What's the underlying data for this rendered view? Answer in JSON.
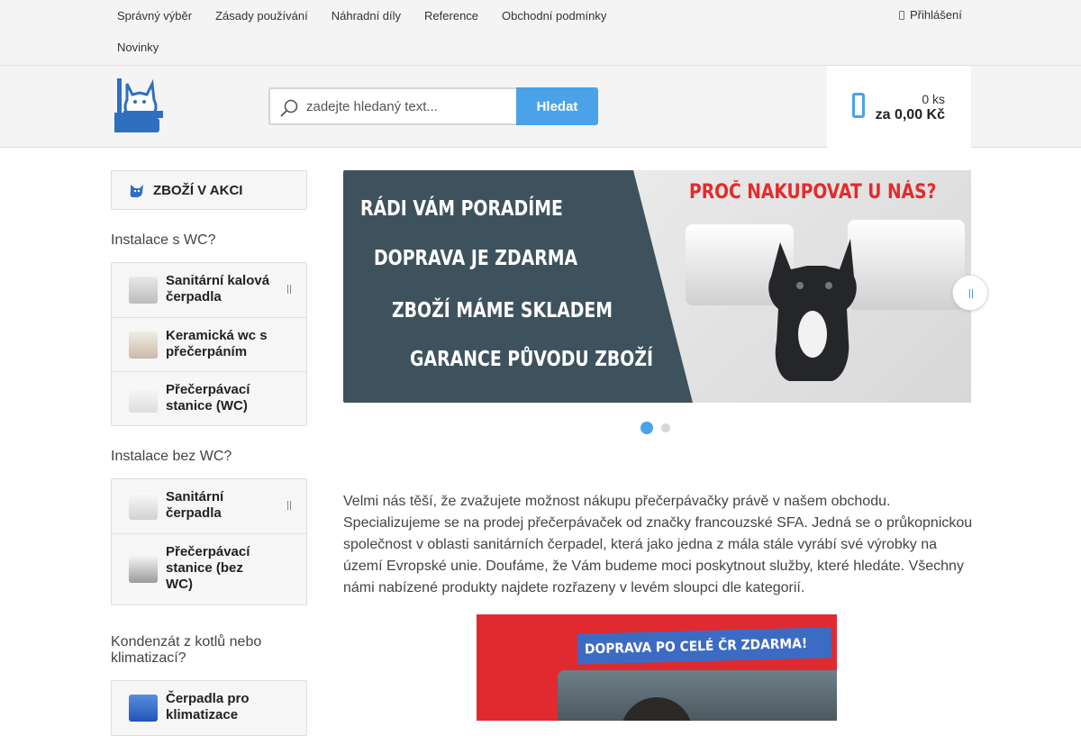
{
  "topnav": {
    "items": [
      "Správný výběr",
      "Zásady používání",
      "Náhradní díly",
      "Reference",
      "Obchodní podmínky",
      "Novinky"
    ],
    "login": "Přihlášení"
  },
  "search": {
    "placeholder": "zadejte hledaný text...",
    "button": "Hledat"
  },
  "cart": {
    "count": "0 ks",
    "total": "za 0,00 Kč"
  },
  "sidebar": {
    "promo": "ZBOŽÍ V AKCI",
    "groups": [
      {
        "title": "Instalace s WC?",
        "items": [
          "Sanitární kalová čerpadla",
          "Keramická wc s přečerpáním",
          "Přečerpávací stanice (WC)"
        ]
      },
      {
        "title": "Instalace bez WC?",
        "items": [
          "Sanitární čerpadla",
          "Přečerpávací stanice (bez WC)"
        ]
      },
      {
        "title": "Kondenzát z kotlů nebo klimatizací?",
        "items": [
          "Čerpadla pro klimatizace"
        ]
      }
    ]
  },
  "banner": {
    "lines": [
      "RÁDI VÁM PORADÍME",
      "DOPRAVA JE ZDARMA",
      "ZBOŽÍ MÁME SKLADEM",
      "GARANCE PŮVODU ZBOŽÍ"
    ],
    "headline": "PROČ NAKUPOVAT U NÁS?",
    "slides": 2,
    "active_slide": 1
  },
  "intro": "Velmi nás těší, že zvažujete možnost nákupu přečerpávačky právě v našem obchodu. Specializujeme se na prodej přečerpávaček od značky francouzské SFA. Jedná se o průkopnickou společnost v oblasti sanitárních čerpadel, která jako jedna z mála stále vyrábí své výrobky na území Evropské unie. Doufáme, že Vám budeme moci poskytnout služby, které hledáte. Všechny námi nabízené produkty najdete rozřazeny v levém sloupci dle kategorií.",
  "promo_image": {
    "text": "DOPRAVA PO CELÉ ČR ZDARMA!"
  },
  "colors": {
    "accent": "#4aa3e8",
    "banner_dark": "#3e525d",
    "banner_red": "#e42b2b",
    "promo_red": "#e02a2f",
    "promo_blue": "#3c6bc4"
  }
}
